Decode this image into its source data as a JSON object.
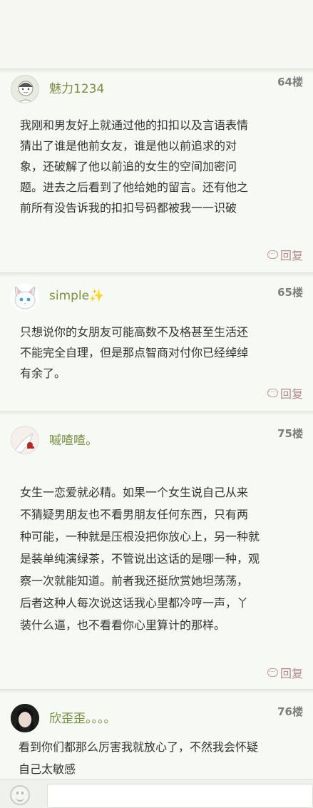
{
  "posts": [
    {
      "username": "魅力1234",
      "floor": "64楼",
      "lines": [
        "我刚和男友好上就通过他的扣扣以及言语表情",
        "猜出了谁是他前女友，谁是他以前追求的对",
        "象，还破解了他以前追的女生的空间加密问",
        "题。进去之后看到了他给她的留言。还有他之",
        "前所有没告诉我的扣扣号码都被我一一识破"
      ],
      "reply_label": "回复"
    },
    {
      "username": "simple✨",
      "floor": "65楼",
      "lines": [
        "只想说你的女朋友可能高数不及格甚至生活还",
        "不能完全自理，但是那点智商对付你已经绰绰",
        "有余了。"
      ],
      "reply_label": "回复"
    },
    {
      "username": "嘁喳喳。",
      "floor": "75楼",
      "lines": [
        "女生一恋爱就必精。如果一个女生说自己从来",
        "不猜疑男朋友也不看男朋友任何东西，只有两",
        "种可能，一种就是压根没把你放心上，另一种就",
        "是装单纯演绿茶，不管说出这话的是哪一种，观",
        "察一次就能知道。前者我还挺欣赏她坦荡荡，",
        "后者这种人每次说这话我心里都冷哼一声，丫",
        "装什么逼，也不看看你心里算计的那样。"
      ],
      "reply_label": "回复"
    },
    {
      "username": "欣歪歪。。。。",
      "floor": "76楼",
      "lines": [
        "看到你们都那么厉害我就放心了，不然我会怀疑",
        "自己太敏感"
      ]
    }
  ],
  "colors": {
    "username": "#7b8f43",
    "reply": "#b28a8a",
    "floor": "#7e7e7e"
  },
  "icons": {
    "reply": "comment-bubble-icon",
    "emoji": "smiley-icon"
  }
}
